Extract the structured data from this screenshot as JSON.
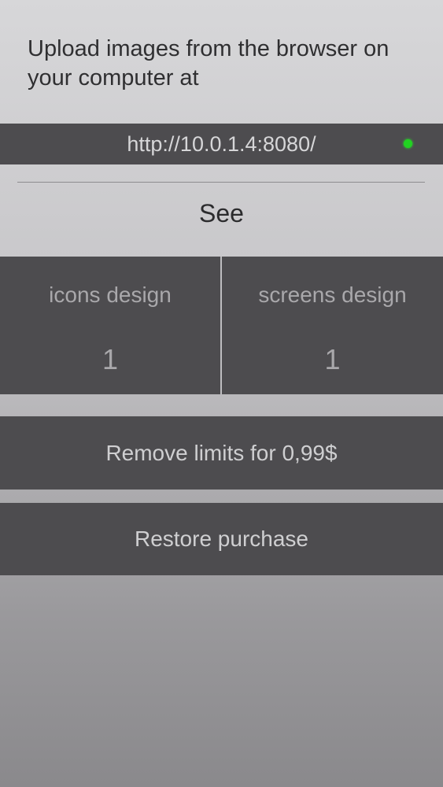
{
  "intro": {
    "line1": "Upload images from the browser on",
    "line2": "your computer at"
  },
  "server": {
    "url": "http://10.0.1.4:8080/",
    "status_color": "#21d321"
  },
  "see": {
    "label": "See"
  },
  "stats": [
    {
      "label": "icons design",
      "value": "1"
    },
    {
      "label": "screens design",
      "value": "1"
    }
  ],
  "actions": {
    "remove_limits": "Remove limits for 0,99$",
    "restore_purchase": "Restore purchase"
  },
  "colors": {
    "bar_background": "#4d4c4f",
    "status_green": "#21d321"
  }
}
